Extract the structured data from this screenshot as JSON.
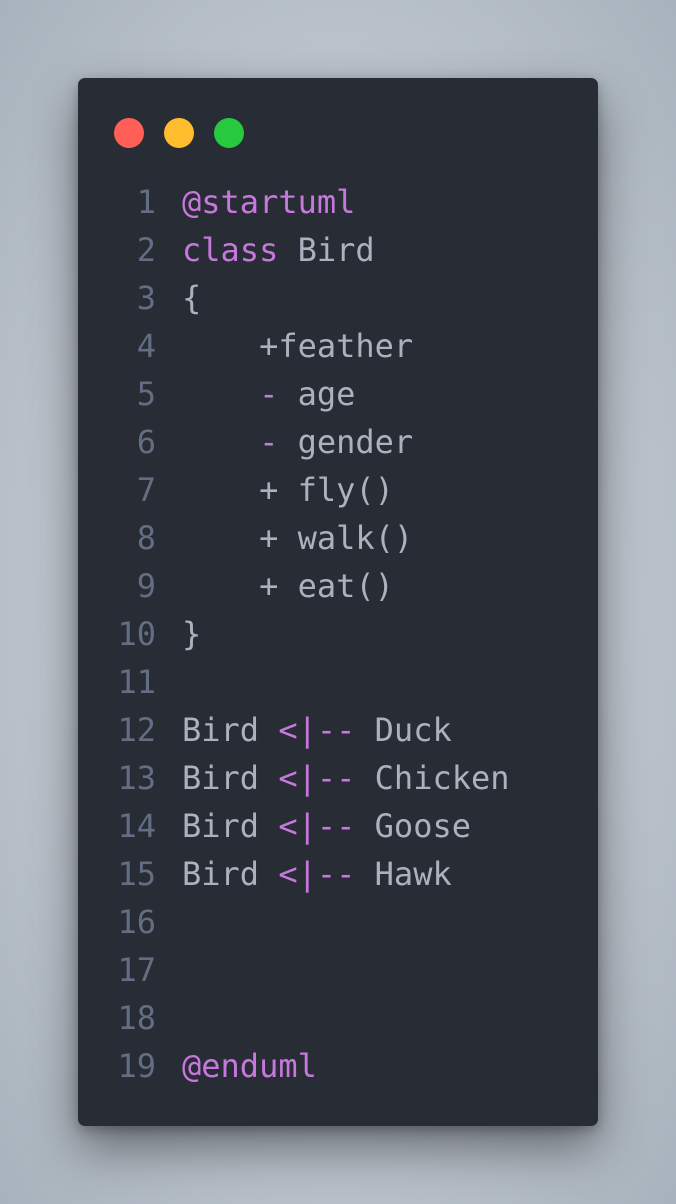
{
  "editor": {
    "window_controls": {
      "close_color": "#ff5f56",
      "minimize_color": "#ffbd2e",
      "maximize_color": "#27c93f"
    },
    "colors": {
      "background": "#282c34",
      "keyword": "#c678dd",
      "text": "#abb2bf",
      "line_number": "#636d83"
    },
    "lines": [
      {
        "n": "1",
        "tokens": [
          {
            "t": "@startuml",
            "k": "kw"
          }
        ]
      },
      {
        "n": "2",
        "tokens": [
          {
            "t": "class",
            "k": "kw"
          },
          {
            "t": " Bird",
            "k": "pl"
          }
        ]
      },
      {
        "n": "3",
        "tokens": [
          {
            "t": "{",
            "k": "pl"
          }
        ]
      },
      {
        "n": "4",
        "tokens": [
          {
            "t": "    +feather",
            "k": "pl"
          }
        ]
      },
      {
        "n": "5",
        "tokens": [
          {
            "t": "    ",
            "k": "pl"
          },
          {
            "t": "-",
            "k": "kw"
          },
          {
            "t": " age",
            "k": "pl"
          }
        ]
      },
      {
        "n": "6",
        "tokens": [
          {
            "t": "    ",
            "k": "pl"
          },
          {
            "t": "-",
            "k": "kw"
          },
          {
            "t": " gender",
            "k": "pl"
          }
        ]
      },
      {
        "n": "7",
        "tokens": [
          {
            "t": "    + fly()",
            "k": "pl"
          }
        ]
      },
      {
        "n": "8",
        "tokens": [
          {
            "t": "    + walk()",
            "k": "pl"
          }
        ]
      },
      {
        "n": "9",
        "tokens": [
          {
            "t": "    + eat()",
            "k": "pl"
          }
        ]
      },
      {
        "n": "10",
        "tokens": [
          {
            "t": "}",
            "k": "pl"
          }
        ]
      },
      {
        "n": "11",
        "tokens": []
      },
      {
        "n": "12",
        "tokens": [
          {
            "t": "Bird ",
            "k": "pl"
          },
          {
            "t": "<|--",
            "k": "kw"
          },
          {
            "t": " Duck",
            "k": "pl"
          }
        ]
      },
      {
        "n": "13",
        "tokens": [
          {
            "t": "Bird ",
            "k": "pl"
          },
          {
            "t": "<|--",
            "k": "kw"
          },
          {
            "t": " Chicken",
            "k": "pl"
          }
        ]
      },
      {
        "n": "14",
        "tokens": [
          {
            "t": "Bird ",
            "k": "pl"
          },
          {
            "t": "<|--",
            "k": "kw"
          },
          {
            "t": " Goose",
            "k": "pl"
          }
        ]
      },
      {
        "n": "15",
        "tokens": [
          {
            "t": "Bird ",
            "k": "pl"
          },
          {
            "t": "<|--",
            "k": "kw"
          },
          {
            "t": " Hawk",
            "k": "pl"
          }
        ]
      },
      {
        "n": "16",
        "tokens": []
      },
      {
        "n": "17",
        "tokens": []
      },
      {
        "n": "18",
        "tokens": []
      },
      {
        "n": "19",
        "tokens": [
          {
            "t": "@enduml",
            "k": "kw"
          }
        ]
      }
    ]
  }
}
